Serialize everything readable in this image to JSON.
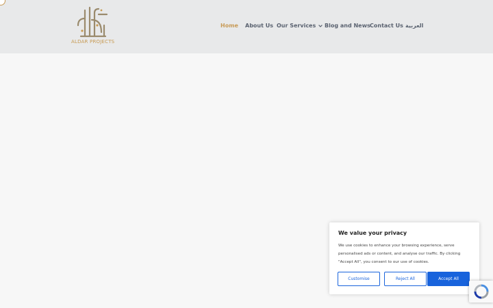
{
  "brand": {
    "logo_text": "ALDAR PROJECTS",
    "logo_icon": "aldar-calligraphy-logo"
  },
  "nav": {
    "items": [
      {
        "label": "Home",
        "active": true
      },
      {
        "label": "About Us",
        "active": false
      },
      {
        "label": "Our Services",
        "active": false,
        "has_dropdown": true
      },
      {
        "label": "Blog and News",
        "active": false
      },
      {
        "label": "Contact Us",
        "active": false
      },
      {
        "label": "العربية",
        "active": false
      }
    ]
  },
  "cookie_banner": {
    "title": "We value your privacy",
    "text": "We use cookies to enhance your browsing experience, serve personalised ads or content, and analyse our traffic. By clicking \"Accept All\", you consent to our use of cookies.",
    "customise_label": "Customise",
    "reject_label": "Reject All",
    "accept_label": "Accept All"
  },
  "colors": {
    "accent": "#c89b57",
    "nav_text": "#5a6270",
    "header_bg": "#e8e9ea",
    "button_blue": "#1863dc"
  },
  "icons": [
    "chevron-down-icon",
    "recaptcha-icon"
  ]
}
